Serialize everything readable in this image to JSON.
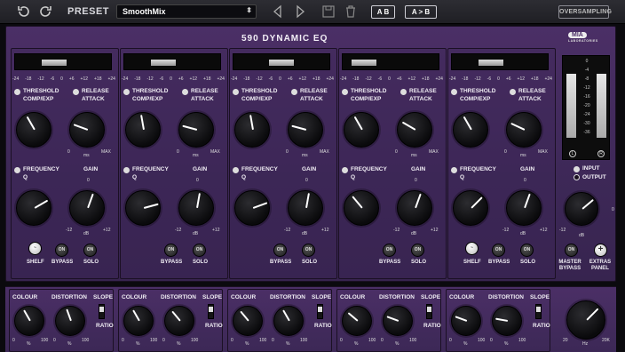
{
  "toolbar": {
    "preset_label": "PRESET",
    "preset_value": "SmoothMix",
    "ab_label": "A B",
    "atob_label": "A > B",
    "oversampling_label": "OVERSAMPLING"
  },
  "plugin": {
    "title": "590 DYNAMIC EQ",
    "logo_text": "MIA",
    "logo_sub": "LABORATORIES"
  },
  "labels": {
    "threshold": "THRESHOLD",
    "comp_exp": "COMP/EXP",
    "release": "RELEASE",
    "attack": "ATTACK",
    "frequency": "FREQUENCY",
    "q": "Q",
    "gain": "GAIN",
    "ms": "ms",
    "max": "MAX",
    "zero": "0",
    "minus12": "-12",
    "plus12": "+12",
    "db": "dB",
    "bypass": "BYPASS",
    "solo": "SOLO",
    "shelf": "SHELF",
    "on": "ON",
    "colour": "COLOUR",
    "distortion": "DISTORTION",
    "slope": "SLOPE",
    "ratio": "RATIO",
    "pct": "%",
    "hundred": "100",
    "input": "INPUT",
    "output": "OUTPUT",
    "master_bypass": "MASTER BYPASS",
    "extras_panel": "EXTRAS PANEL",
    "hz": "Hz",
    "twenty": "20",
    "twentyk": "20K",
    "L": "L",
    "R": "R"
  },
  "meter_scale": [
    "-24",
    "-18",
    "-12",
    "-6",
    "0",
    "+6",
    "+12",
    "+18",
    "+24"
  ],
  "big_meter_scale": [
    "0",
    "-4",
    "-8",
    "-12",
    "-16",
    "-20",
    "-24",
    "-30",
    "-36"
  ],
  "channels": [
    {
      "has_shelf": true
    },
    {
      "has_shelf": false
    },
    {
      "has_shelf": false
    },
    {
      "has_shelf": false
    },
    {
      "has_shelf": true
    }
  ]
}
